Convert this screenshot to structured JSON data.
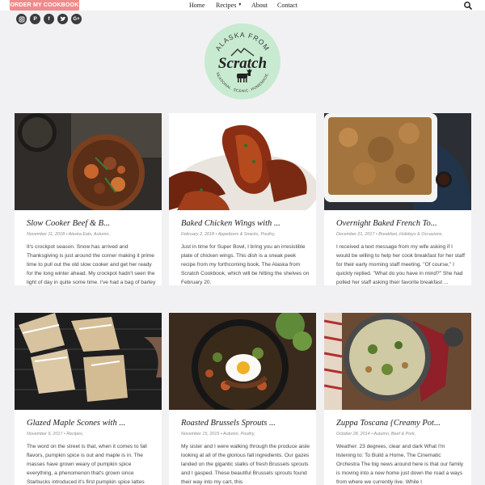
{
  "header": {
    "order_button": "ORDER MY COOKBOOK",
    "nav": [
      {
        "label": "Home"
      },
      {
        "label": "Recipes",
        "dropdown": true
      },
      {
        "label": "About"
      },
      {
        "label": "Contact"
      }
    ],
    "search_icon": "search-icon"
  },
  "social": [
    "instagram-icon",
    "pinterest-icon",
    "facebook-icon",
    "twitter-icon",
    "google-plus-icon"
  ],
  "logo": {
    "top_text": "ALASKA FROM",
    "script_text": "Scratch",
    "bottom_text": "SEASONAL. SCENIC. HOMEMADE.",
    "bg_color": "#c7ead0"
  },
  "posts": [
    {
      "title": "Slow Cooker Beef & B...",
      "date": "November 11, 2018",
      "categories": "Alaska Eats, Autumn,",
      "excerpt": "It's crockpot season. Snow has arrived and Thanksgiving is just around the corner making it prime time to pull out the old slow cooker and get her ready for the long winter ahead. My crockpot hadn't seen the light of day in quite some time. I've had a bag of barley from ..."
    },
    {
      "title": "Baked Chicken Wings with ...",
      "date": "February 2, 2018",
      "categories": "Appetizers & Snacks, Poultry,",
      "excerpt": "Just in time for Super Bowl, I bring you an irresistible plate of chicken wings. This dish is a sneak peek recipe from my forthcoming book, The Alaska from Scratch Cookbook, which will be hitting the shelves on February 20."
    },
    {
      "title": "Overnight Baked French To...",
      "date": "December 21, 2017",
      "categories": "Breakfast, Holidays & Occasions,",
      "excerpt": "I received a text message from my wife asking if I would be willing to help her cook breakfast for her staff for their early morning staff meeting. \"Of course,\" I quickly replied. \"What do you have in mind?\" She had polled her staff asking their favorite breakfast ..."
    },
    {
      "title": "Glazed Maple Scones with ...",
      "date": "November 9, 2017",
      "categories": "Recipes,",
      "excerpt": "The word on the street is that, when it comes to fall flavors, pumpkin spice is out and maple is in. The masses have grown weary of pumpkin spice everything, a phenomenon that's grown since Starbucks introduced it's first pumpkin spice lattes"
    },
    {
      "title": "Roasted Brussels Sprouts ...",
      "date": "November 15, 2015",
      "categories": "Autumn, Poultry,",
      "excerpt": "My sister and I were walking through the produce aisle looking at all of the glorious fall ingredients. Our gazes landed on the gigantic stalks of fresh Brussels sprouts and I gasped. These beautiful Brussels sprouts found their way into my cart, this"
    },
    {
      "title": "Zuppa Toscana {Creamy Pot...",
      "date": "October 28, 2014",
      "categories": "Autumn, Beef & Pork,",
      "excerpt": "Weather: 23 degrees, clear and dark What I'm listening to: To Build a Home, The Cinematic Orchestra The big news around here is that our family is moving into a new home just down the road a ways from where we currently live. While I"
    }
  ]
}
